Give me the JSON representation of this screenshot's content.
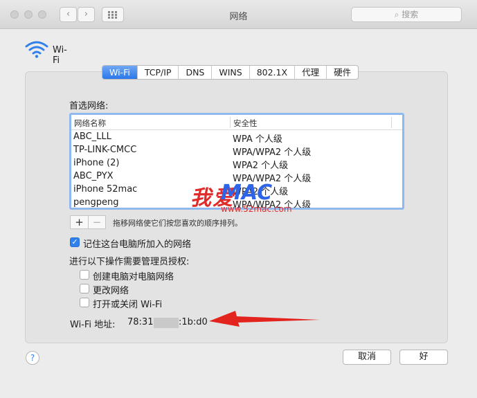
{
  "window": {
    "title": "网络",
    "search_placeholder": "搜索",
    "back_icon": "‹",
    "forward_icon": "›"
  },
  "interface": {
    "name": "Wi-Fi",
    "icon": "wifi-icon",
    "accent": "#2f80ed"
  },
  "tabs": [
    {
      "label": "Wi-Fi",
      "active": true
    },
    {
      "label": "TCP/IP",
      "active": false
    },
    {
      "label": "DNS",
      "active": false
    },
    {
      "label": "WINS",
      "active": false
    },
    {
      "label": "802.1X",
      "active": false
    },
    {
      "label": "代理",
      "active": false
    },
    {
      "label": "硬件",
      "active": false
    }
  ],
  "preferred": {
    "title": "首选网络:",
    "columns": [
      "网络名称",
      "安全性"
    ],
    "rows": [
      {
        "name": "ABC_LLL",
        "security": "WPA 个人级"
      },
      {
        "name": "TP-LINK-CMCC",
        "security": "WPA/WPA2 个人级"
      },
      {
        "name": "iPhone (2)",
        "security": "WPA2 个人级"
      },
      {
        "name": "ABC_PYX",
        "security": "WPA/WPA2 个人级"
      },
      {
        "name": "iPhone 52mac",
        "security": "WPA2 个人级"
      },
      {
        "name": "pengpeng",
        "security": "WPA/WPA2 个人级"
      }
    ],
    "add_label": "+",
    "remove_label": "−",
    "hint": "拖移网络使它们按您喜欢的顺序排列。"
  },
  "options": {
    "remember_label": "记住这台电脑所加入的网络",
    "remember_checked": true,
    "admin_title": "进行以下操作需要管理员授权:",
    "admin_items": [
      {
        "label": "创建电脑对电脑网络",
        "checked": false
      },
      {
        "label": "更改网络",
        "checked": false
      },
      {
        "label": "打开或关闭 Wi-Fi",
        "checked": false
      }
    ]
  },
  "address": {
    "label": "Wi-Fi 地址:",
    "value_start": "78:31:",
    "value_end": ":1b:d0"
  },
  "watermark": {
    "cn": "我爱",
    "en": "MAC",
    "url": "www.52mac.com"
  },
  "footer": {
    "help_label": "?",
    "cancel_label": "取消",
    "ok_label": "好"
  }
}
